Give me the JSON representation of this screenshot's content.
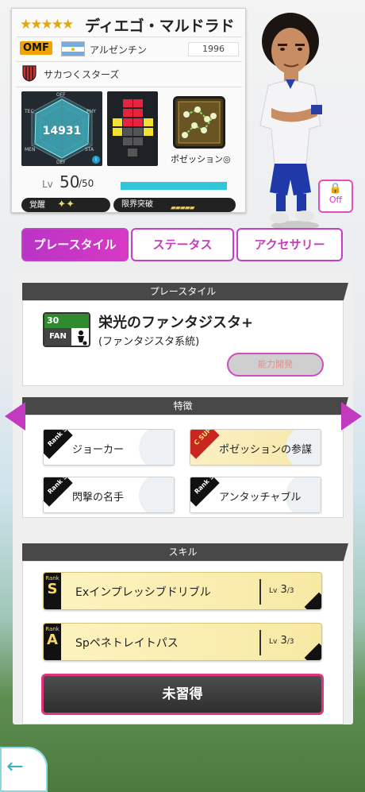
{
  "card": {
    "stars": "★★★★★",
    "name": "ディエゴ・マルドラド",
    "position": "OMF",
    "nationality": "アルゼンチン",
    "birth_year": "1996",
    "team": "サカつくスターズ",
    "radar": {
      "total": "14931",
      "labels": {
        "off": "OFF",
        "tec": "TEC",
        "phy": "PHY",
        "men": "MEN",
        "sta": "STA",
        "def": "DEF"
      }
    },
    "possession_label": "ポゼッション◎",
    "level_label": "Lv",
    "level_current": "50",
    "level_max": "/50",
    "awaken_label": "覚醒",
    "awaken_diamonds": "✦✦",
    "limit_label": "限界突破",
    "limit_bars": "▰▰▰▰▰"
  },
  "lock_button": {
    "label": "Off",
    "icon": "lock-icon"
  },
  "tabs": [
    {
      "label": "プレースタイル",
      "active": true
    },
    {
      "label": "ステータス",
      "active": false
    },
    {
      "label": "アクセサリー",
      "active": false
    }
  ],
  "play_style": {
    "header": "プレースタイル",
    "icon_number": "30",
    "icon_text": "FAN",
    "title": "栄光のファンタジスタ+",
    "subtitle": "(ファンタジスタ系統)",
    "button": "能力開発"
  },
  "traits": {
    "header": "特徴",
    "items": [
      {
        "rank": "Rank S",
        "label": "ジョーカー",
        "gold": false
      },
      {
        "rank": "C SUP",
        "label": "ポゼッションの参謀",
        "gold": true
      },
      {
        "rank": "Rank S",
        "label": "閃撃の名手",
        "gold": false
      },
      {
        "rank": "Rank S",
        "label": "アンタッチャブル",
        "gold": false
      }
    ]
  },
  "skills": {
    "header": "スキル",
    "items": [
      {
        "rank_word": "Rank",
        "rank": "S",
        "name": "Exインプレッシブドリブル",
        "lv_label": "Lv",
        "lv": "3",
        "lv_max": "/3"
      },
      {
        "rank_word": "Rank",
        "rank": "A",
        "name": "Spペネトレイトパス",
        "lv_label": "Lv",
        "lv": "3",
        "lv_max": "/3"
      }
    ],
    "unlearned_button": "未習得"
  },
  "back_arrow": "←",
  "colors": {
    "accent": "#c83bbd",
    "level_bar": "#30c6d9",
    "position_badge": "#f0a400"
  }
}
